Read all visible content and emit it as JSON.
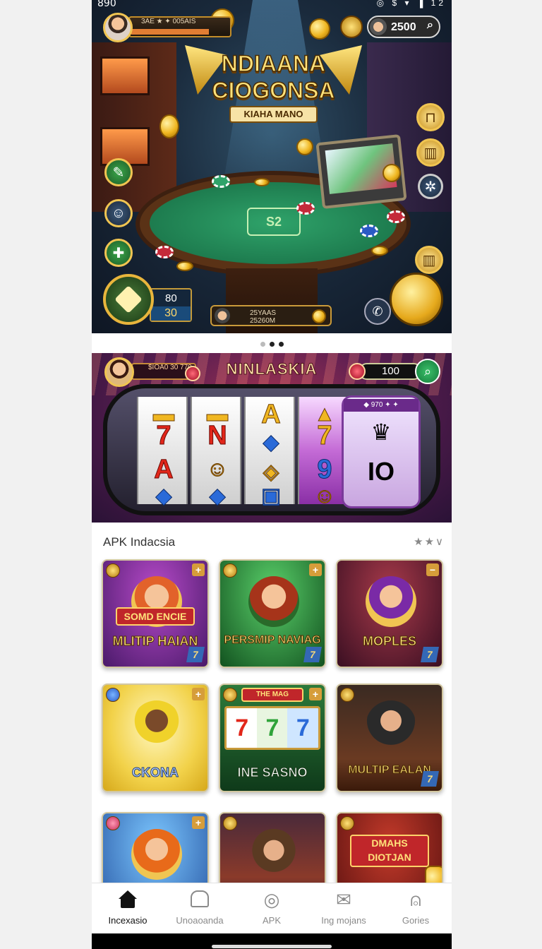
{
  "status_bar": {
    "time": "890",
    "icons": "◎ $ ▾ ▐ 12"
  },
  "hero": {
    "title_line1": "NDIAANA",
    "title_line2": "CIOGONSA",
    "subtitle": "KIAHA MANO",
    "table_logo": "S2",
    "hud_bar_text": "3AE ★ ✦ 005AIS",
    "balance": "2500",
    "stat_top": "80",
    "stat_bottom": "30",
    "player_line1": "25YAAS",
    "player_line2": "25260M"
  },
  "carousel": {
    "count": 3,
    "active_index": 1
  },
  "slot_banner": {
    "title": "NINLASKIA",
    "bar_text": "$IOA0\n30 770",
    "balance": "100",
    "panel_top": "◆ 970 ✦ ✦",
    "reel_symbols": [
      [
        "7",
        "A"
      ],
      [
        "N",
        "☺"
      ],
      [
        "A",
        "◈"
      ],
      [
        "7",
        "9"
      ]
    ],
    "panel_symbol": "IO"
  },
  "section": {
    "label": "APK Indacsia",
    "controls": "★★∨"
  },
  "tiles": [
    {
      "subtitle": "SOMD ENCIE",
      "title": "MLITIP HAIAN",
      "corner": "+",
      "rank": "7"
    },
    {
      "subtitle": "",
      "title": "PERSMIP NAVIAG",
      "corner": "+",
      "rank": "7"
    },
    {
      "subtitle": "",
      "title": "MOPLES",
      "corner": "−",
      "rank": "7"
    },
    {
      "subtitle": "",
      "title": "CKONA",
      "corner": "+",
      "rank": ""
    },
    {
      "subtitle": "THE MAG",
      "title": "INE SASNO",
      "corner": "+",
      "rank": ""
    },
    {
      "subtitle": "",
      "title": "MULTIP EALAN",
      "corner": "",
      "rank": "7"
    },
    {
      "subtitle": "",
      "title": "",
      "corner": "+",
      "rank": ""
    },
    {
      "subtitle": "",
      "title": "",
      "corner": "",
      "rank": ""
    },
    {
      "subtitle": "DMAHS DIOTJAN",
      "title": "",
      "corner": "",
      "rank": ""
    }
  ],
  "bottom_nav": [
    {
      "label": "Incexasio",
      "icon": "home-icon",
      "active": true
    },
    {
      "label": "Unoaoanda",
      "icon": "home-outline-icon",
      "active": false
    },
    {
      "label": "APK",
      "icon": "compass-icon",
      "active": false
    },
    {
      "label": "Ing mojans",
      "icon": "mail-icon",
      "active": false
    },
    {
      "label": "Gories",
      "icon": "profile-icon",
      "active": false
    }
  ]
}
